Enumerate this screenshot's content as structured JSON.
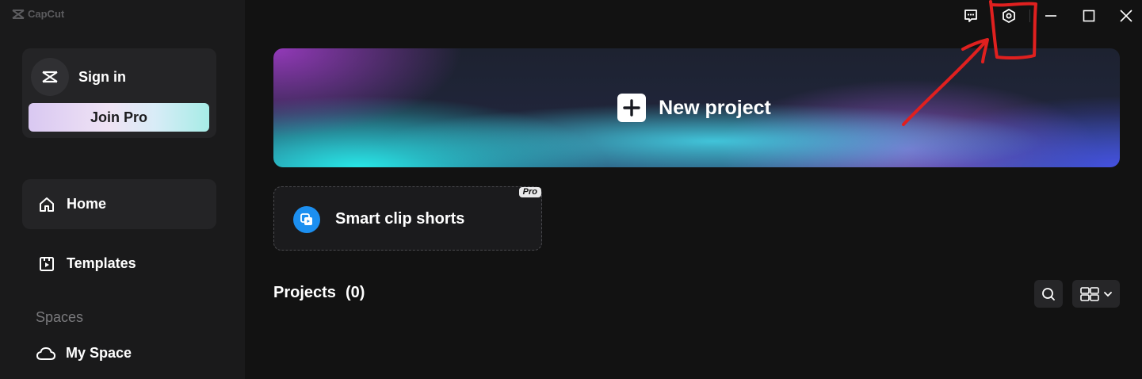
{
  "app": {
    "brand": "CapCut"
  },
  "sidebar": {
    "sign_in": "Sign in",
    "join_pro": "Join Pro",
    "nav": [
      {
        "label": "Home",
        "icon": "home-icon",
        "active": true
      },
      {
        "label": "Templates",
        "icon": "templates-icon",
        "active": false
      }
    ],
    "spaces_label": "Spaces",
    "my_space": "My Space"
  },
  "titlebar": {
    "icons": [
      "feedback-icon",
      "settings-icon",
      "minimize-icon",
      "maximize-icon",
      "close-icon"
    ]
  },
  "main": {
    "new_project": "New project",
    "smart_clip": {
      "label": "Smart clip shorts",
      "badge": "Pro"
    },
    "projects": {
      "title": "Projects",
      "count": "(0)"
    }
  },
  "annotation": {
    "color": "#e0201f"
  }
}
